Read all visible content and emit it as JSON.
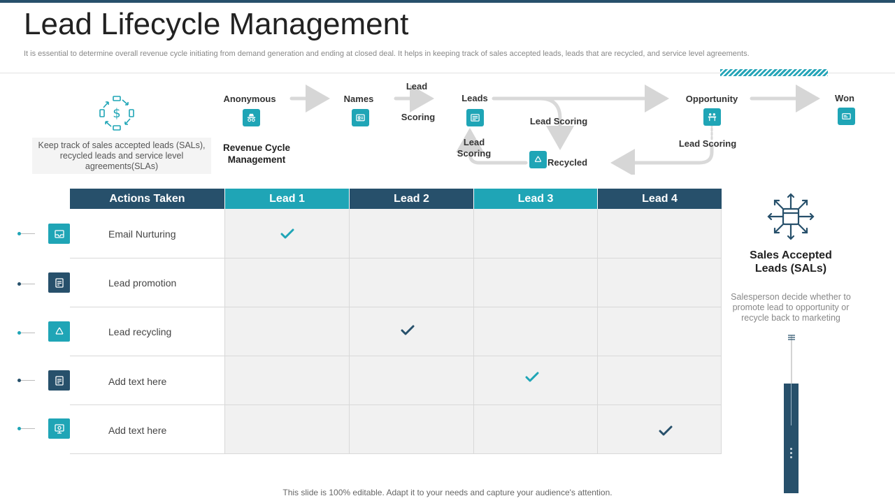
{
  "page": {
    "title": "Lead Lifecycle Management",
    "subtitle": "It is essential to determine overall revenue cycle initiating from demand generation and ending at closed deal. It helps in keeping track of sales accepted leads, leads that are recycled, and service level agreements.",
    "footer": "This slide is 100% editable. Adapt it to your needs and capture your audience's attention."
  },
  "left_panel": {
    "description": "Keep track of sales accepted leads (SALs), recycled leads and service level agreements(SLAs)",
    "icon": "dollar-cycle-icon"
  },
  "flow": {
    "anonymous": "Anonymous",
    "names": "Names",
    "lead_scoring_top_1": "Lead",
    "lead_scoring_top_2": "Scoring",
    "leads": "Leads",
    "opportunity": "Opportunity",
    "won": "Won",
    "revenue_cycle_1": "Revenue Cycle",
    "revenue_cycle_2": "Management",
    "lead_scoring_mid": "Lead Scoring",
    "lead_scoring_left_1": "Lead",
    "lead_scoring_left_2": "Scoring",
    "lead_scoring_right": "Lead Scoring",
    "recycled": "Recycled"
  },
  "table": {
    "headers": [
      "Actions Taken",
      "Lead 1",
      "Lead 2",
      "Lead 3",
      "Lead 4"
    ],
    "rows": [
      {
        "action": "Email Nurturing",
        "check": 1
      },
      {
        "action": "Lead promotion",
        "check": 0
      },
      {
        "action": "Lead recycling",
        "check": 2
      },
      {
        "action": "Add text here",
        "check": 3
      },
      {
        "action": "Add text here",
        "check": 4
      }
    ]
  },
  "right_panel": {
    "title_1": "Sales Accepted",
    "title_2": "Leads (SALs)",
    "description": "Salesperson decide whether to promote lead to opportunity or recycle back to marketing",
    "icon": "network-hub-icon"
  },
  "colors": {
    "teal": "#1fa5b6",
    "navy": "#27506b",
    "gray_cell": "#f1f1f1"
  }
}
